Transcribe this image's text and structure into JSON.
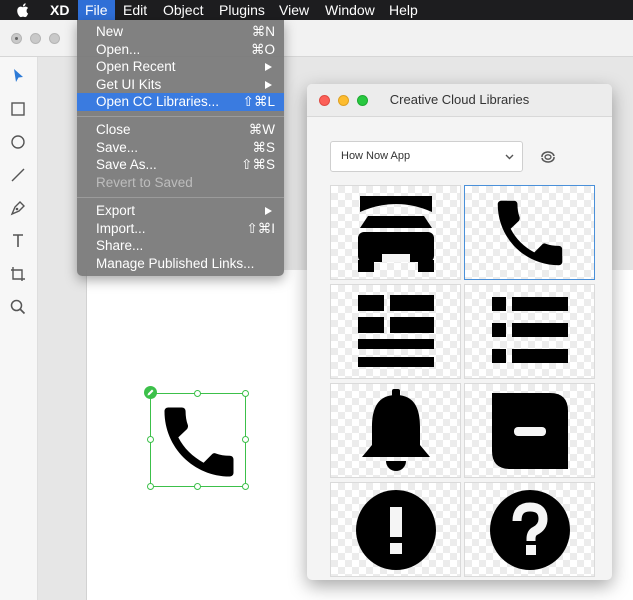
{
  "menubar": {
    "app": "XD",
    "items": [
      "File",
      "Edit",
      "Object",
      "Plugins",
      "View",
      "Window",
      "Help"
    ],
    "active": "File"
  },
  "file_menu": {
    "items": [
      {
        "label": "New",
        "shortcut": "⌘N"
      },
      {
        "label": "Open...",
        "shortcut": "⌘O"
      },
      {
        "label": "Open Recent",
        "submenu": true
      },
      {
        "label": "Get UI Kits",
        "submenu": true
      },
      {
        "label": "Open CC Libraries...",
        "shortcut": "⇧⌘L",
        "highlighted": true
      },
      {
        "label": "Close",
        "shortcut": "⌘W"
      },
      {
        "label": "Save...",
        "shortcut": "⌘S"
      },
      {
        "label": "Save As...",
        "shortcut": "⇧⌘S"
      },
      {
        "label": "Revert to Saved",
        "disabled": true
      },
      {
        "label": "Export",
        "submenu": true
      },
      {
        "label": "Import...",
        "shortcut": "⇧⌘I"
      },
      {
        "label": "Share..."
      },
      {
        "label": "Manage Published Links..."
      }
    ]
  },
  "libraries_panel": {
    "title": "Creative Cloud Libraries",
    "library_select": "How Now App",
    "icons": [
      "bed-icon",
      "phone-icon",
      "article-list-icon",
      "bulleted-list-icon",
      "bell-icon",
      "minus-square-icon",
      "exclamation-circle-icon",
      "question-circle-icon"
    ],
    "selected_icon": "phone-icon"
  },
  "colors": {
    "menubar": "#1d1d1f",
    "menu_highlight": "#3a7be0",
    "selection": "#3cc04a",
    "tile_selected": "#4a90d9"
  }
}
